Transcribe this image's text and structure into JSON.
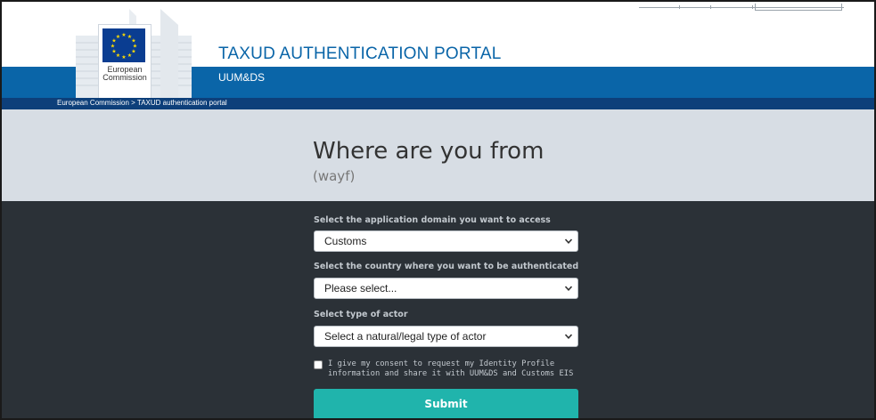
{
  "header": {
    "logo_lines": [
      "European",
      "Commission"
    ],
    "title": "TAXUD AUTHENTICATION PORTAL",
    "subtitle": "UUM&DS"
  },
  "breadcrumb": {
    "text": "European Commission > TAXUD authentication portal"
  },
  "hero": {
    "title": "Where are you from",
    "subtitle": "(wayf)"
  },
  "form": {
    "domain": {
      "label": "Select the application domain you want to access",
      "value": "Customs"
    },
    "country": {
      "label": "Select the country where you want to be authenticated",
      "value": "Please select..."
    },
    "actor": {
      "label": "Select type of actor",
      "value": "Select a natural/legal type of actor"
    },
    "consent": {
      "text": "I give my consent to request my Identity Profile information and share it with UUM&DS and Customs EIS",
      "checked": false
    },
    "submit_label": "Submit"
  },
  "colors": {
    "brand_blue": "#0a65a8",
    "breadcrumb_bg": "#0d3f7a",
    "hero_bg": "#d7dde4",
    "main_bg": "#2b3137",
    "submit_bg": "#20b4ac"
  }
}
